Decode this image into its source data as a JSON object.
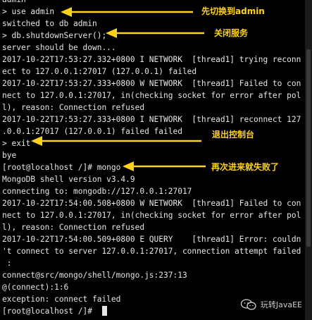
{
  "terminal": {
    "lines": [
      "admin",
      "> use admin",
      "switched to db admin",
      "> db.shutdownServer();",
      "server should be down...",
      "2017-10-22T17:53:27.332+0800 I NETWORK  [thread1] trying reconn",
      "ect to 127.0.0.1:27017 (127.0.0.1) failed",
      "2017-10-22T17:53:27.333+0800 W NETWORK  [thread1] Failed to con",
      "nect to 127.0.0.1:27017, in(checking socket for error after pol",
      "l), reason: Connection refused",
      "2017-10-22T17:53:27.333+0800 I NETWORK  [thread1] reconnect 127",
      ".0.0.1:27017 (127.0.0.1) failed failed",
      "> exit",
      "bye",
      "[root@localhost /]# mongo",
      "MongoDB shell version v3.4.9",
      "connecting to: mongodb://127.0.0.1:27017",
      "2017-10-22T17:54:00.508+0800 W NETWORK  [thread1] Failed to con",
      "nect to 127.0.0.1:27017, in(checking socket for error after pol",
      "l), reason: Connection refused",
      "2017-10-22T17:54:00.509+0800 E QUERY    [thread1] Error: couldn",
      "'t connect to server 127.0.0.1:27017, connection attempt failed",
      " :",
      "connect@src/mongo/shell/mongo.js:237:13",
      "@(connect):1:6",
      "exception: connect failed",
      "[root@localhost /]# "
    ]
  },
  "annotations": [
    {
      "label": "先切换到admin"
    },
    {
      "label": "关闭服务"
    },
    {
      "label": "退出控制台"
    },
    {
      "label": "再次进来就失败了"
    }
  ],
  "watermark": {
    "text": "玩转JavaEE",
    "icon": "wechat-icon"
  },
  "colors": {
    "background": "#000000",
    "text": "#e6e6e6",
    "annotation": "#ffd21a"
  }
}
